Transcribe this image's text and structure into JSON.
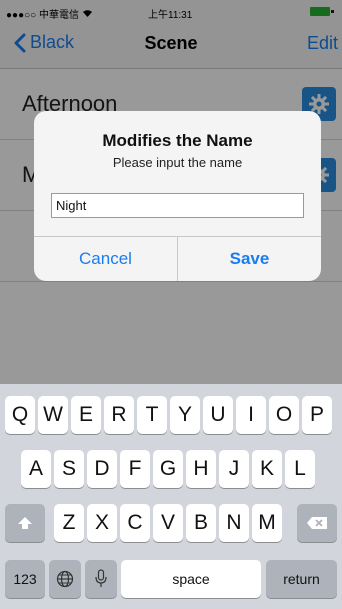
{
  "status_bar": {
    "carrier": "●●●○○ 中華電信",
    "time": "上午11:31"
  },
  "nav": {
    "back_label": "Black",
    "title": "Scene",
    "edit_label": "Edit"
  },
  "list": {
    "items": [
      {
        "label": "Afternoon"
      },
      {
        "label": "M"
      }
    ]
  },
  "dialog": {
    "title": "Modifies the Name",
    "message": "Please input the name",
    "input_value": "Night",
    "cancel_label": "Cancel",
    "save_label": "Save"
  },
  "keyboard": {
    "row1": [
      "Q",
      "W",
      "E",
      "R",
      "T",
      "Y",
      "U",
      "I",
      "O",
      "P"
    ],
    "row2": [
      "A",
      "S",
      "D",
      "F",
      "G",
      "H",
      "J",
      "K",
      "L"
    ],
    "row3": [
      "Z",
      "X",
      "C",
      "V",
      "B",
      "N",
      "M"
    ],
    "numbers_label": "123",
    "space_label": "space",
    "return_label": "return"
  },
  "colors": {
    "accent": "#1a7df0",
    "gear_button": "#2b8de0",
    "keyboard_bg": "#d2d5db"
  }
}
